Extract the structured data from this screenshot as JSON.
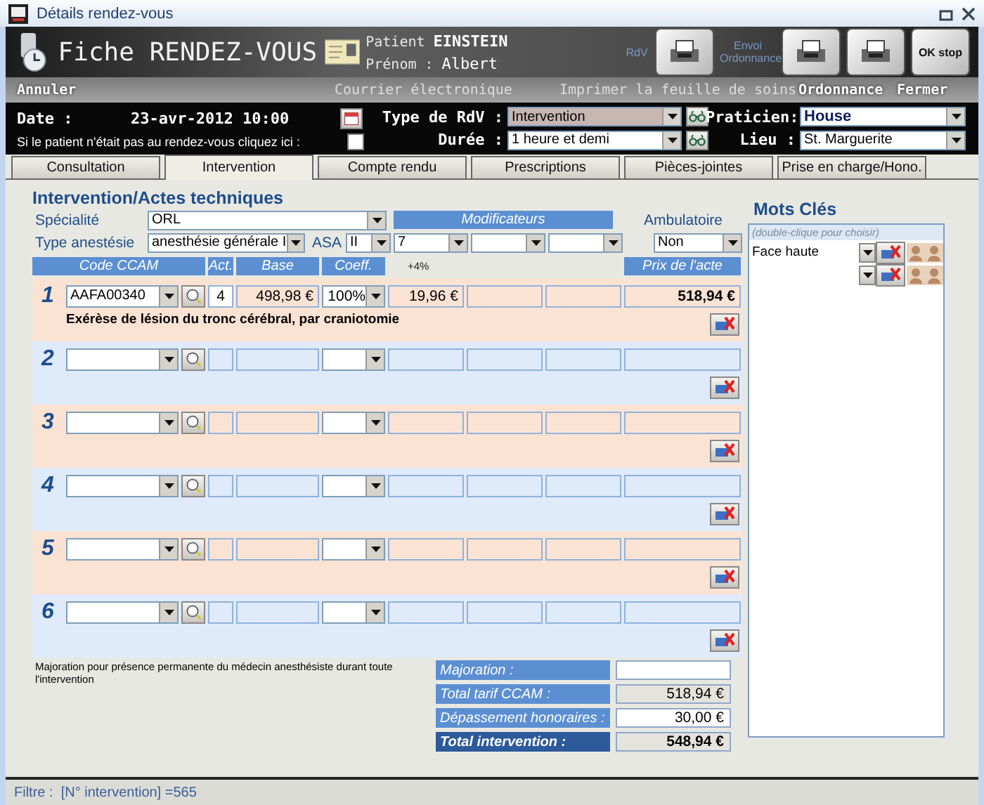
{
  "window": {
    "title": "Détails rendez-vous"
  },
  "header": {
    "title": "Fiche RENDEZ-VOUS",
    "patient_label": "Patient",
    "patient_name": "EINSTEIN",
    "firstname_label": "Prénom :",
    "firstname": "Albert",
    "toolbar": [
      {
        "kind": "text",
        "label": "RdV"
      },
      {
        "kind": "key"
      },
      {
        "kind": "text",
        "label": "Envoi Ordonnance"
      },
      {
        "kind": "key"
      },
      {
        "kind": "key"
      },
      {
        "kind": "key",
        "label": "OK stop"
      }
    ]
  },
  "menu": [
    {
      "label": "Annuler",
      "disabled": false
    },
    {
      "label": "Courrier électronique",
      "disabled": true
    },
    {
      "label": "Imprimer la feuille de soins",
      "disabled": true
    },
    {
      "label": "Ordonnance",
      "disabled": false
    },
    {
      "label": "Fermer",
      "disabled": false
    }
  ],
  "appointment": {
    "date_label": "Date :",
    "date": "23-avr-2012 10:00",
    "absent_label": "Si le patient n'était pas au rendez-vous cliquez ici :",
    "absent_checked": false,
    "type_label": "Type de RdV :",
    "type": "Intervention",
    "duration_label": "Durée :",
    "duration": "1 heure et demi",
    "practitioner_label": "Praticien:",
    "practitioner": "House",
    "place_label": "Lieu :",
    "place": "St. Marguerite"
  },
  "tabs": [
    {
      "label": "Consultation",
      "selected": false
    },
    {
      "label": "Intervention",
      "selected": true
    },
    {
      "label": "Compte rendu",
      "selected": false
    },
    {
      "label": "Prescriptions",
      "selected": false
    },
    {
      "label": "Pièces-jointes",
      "selected": false
    },
    {
      "label": "Prise en charge/Hono.",
      "selected": false
    }
  ],
  "section": {
    "title": "Intervention/Actes techniques",
    "specialty_label": "Spécialité",
    "specialty": "ORL",
    "anesthesia_label": "Type anestésie",
    "anesthesia": "anesthésie générale I",
    "asa_label": "ASA",
    "asa": "II",
    "modifiers_label": "Modificateurs",
    "modifiers": [
      "7"
    ],
    "ambulatory_label": "Ambulatoire",
    "ambulatory": "Non"
  },
  "columns": [
    {
      "label": "Code CCAM",
      "kind": "code"
    },
    {
      "label": "Act.",
      "kind": "activity"
    },
    {
      "label": "Base",
      "kind": "base"
    },
    {
      "label": "Coeff.",
      "kind": "coeff"
    },
    {
      "label": "+4%",
      "kind": "modifier"
    },
    {
      "label": "Prix de l'acte",
      "kind": "price"
    }
  ],
  "acts": [
    {
      "number": "1",
      "code": "AAFA00340",
      "activity": "4",
      "base": "498,98 €",
      "coeff": "100%",
      "modifier_1": "19,96 €",
      "price": "518,94 €",
      "description": "Exérèse de lésion du tronc cérébral, par craniotomie"
    },
    {
      "number": "2"
    },
    {
      "number": "3"
    },
    {
      "number": "4"
    },
    {
      "number": "5"
    },
    {
      "number": "6"
    }
  ],
  "note": "Majoration pour présence permanente du médecin anesthésiste durant toute l'intervention",
  "totals": [
    {
      "label": "Majoration :",
      "kind": "input"
    },
    {
      "label": "Total tarif CCAM :",
      "kind": "computed",
      "value": "518,94 €"
    },
    {
      "label": "Dépassement honoraires :",
      "kind": "input",
      "value": "30,00 €"
    },
    {
      "label": "Total intervention :",
      "kind": "total",
      "value": "548,94 €"
    }
  ],
  "keywords": {
    "title": "Mots Clés",
    "hint": "(double-clique pour choisir)",
    "items": [
      {
        "kind": "text",
        "label": "Face haute"
      },
      {
        "kind": "empty"
      }
    ]
  },
  "status_bar": "Filtre :  [N° intervention] =565"
}
